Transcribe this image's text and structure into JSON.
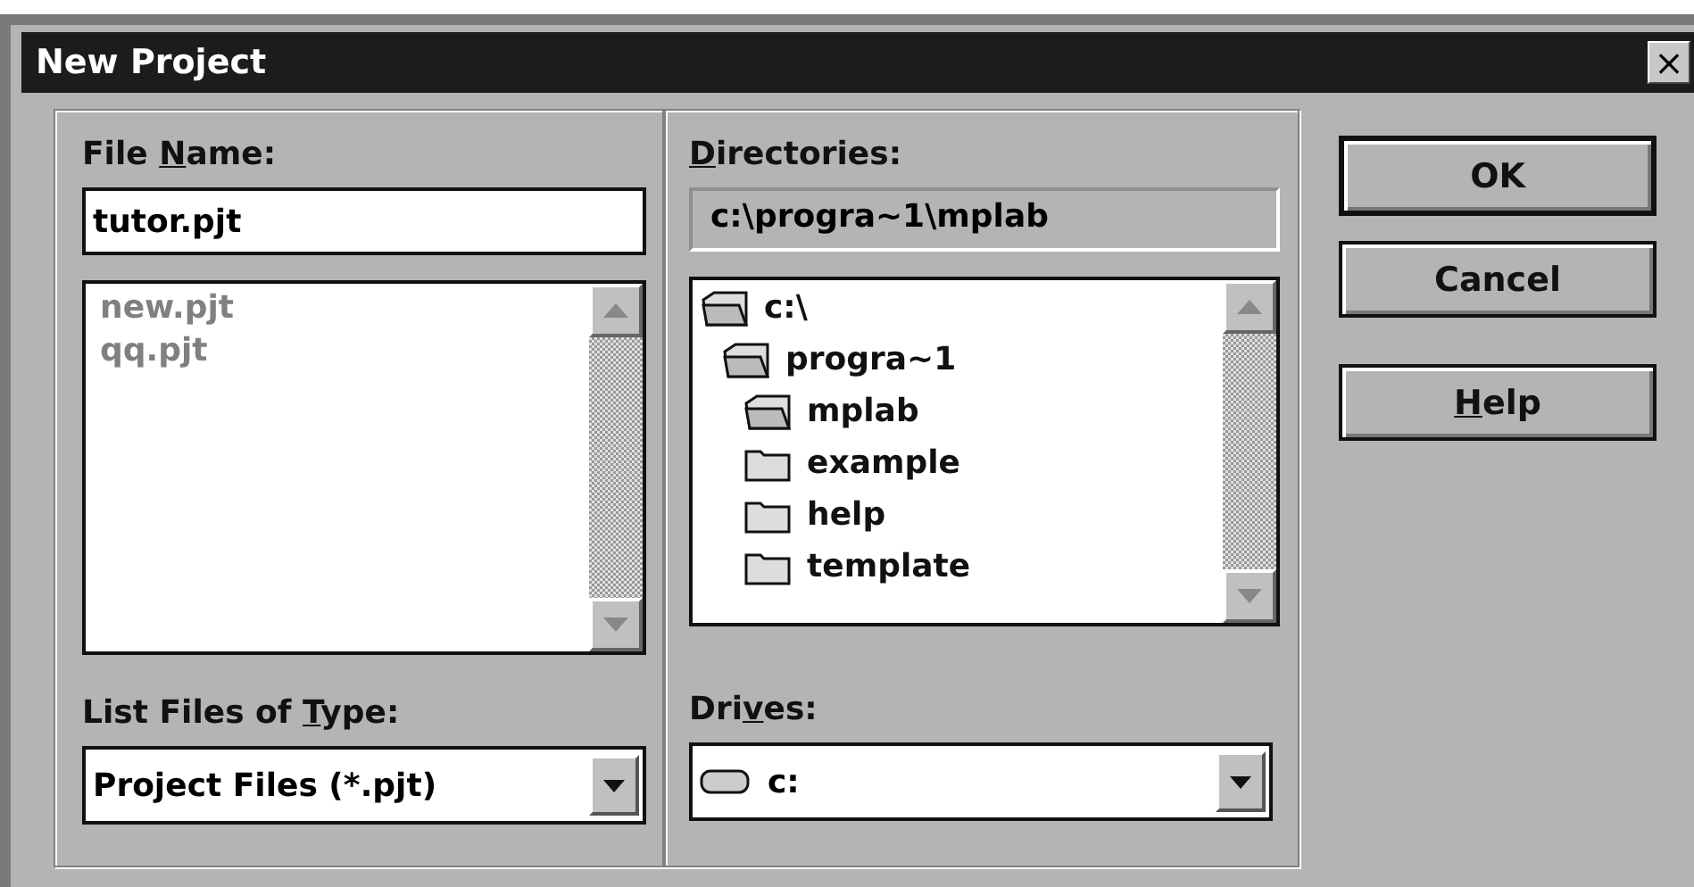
{
  "window": {
    "title": "New Project",
    "close": "×"
  },
  "file_name": {
    "label": {
      "before": "File ",
      "key": "N",
      "after": "ame:"
    },
    "value": "tutor.pjt"
  },
  "files": [
    {
      "name": "new.pjt"
    },
    {
      "name": "qq.pjt"
    }
  ],
  "file_type": {
    "label": {
      "before": "List Files of ",
      "key": "T",
      "after": "ype:"
    },
    "value": "Project Files (*.pjt)"
  },
  "directories": {
    "label": {
      "key": "D",
      "after": "irectories:"
    },
    "path": "c:\\progra~1\\mplab",
    "tree": [
      {
        "name": "c:\\",
        "expanded": true,
        "children": [
          {
            "name": "progra~1",
            "expanded": true,
            "children": [
              {
                "name": "mplab",
                "expanded": true,
                "children": [
                  {
                    "name": "example",
                    "expanded": false
                  },
                  {
                    "name": "help",
                    "expanded": false
                  },
                  {
                    "name": "template",
                    "expanded": false
                  }
                ]
              }
            ]
          }
        ]
      }
    ]
  },
  "drives": {
    "label": {
      "before": "Dri",
      "key": "v",
      "after": "es:"
    },
    "value": "c:"
  },
  "buttons": [
    {
      "label": {
        "after": "OK"
      },
      "default": true
    },
    {
      "label": {
        "after": "Cancel"
      },
      "default": false
    },
    {
      "label": {
        "key": "H",
        "after": "elp"
      },
      "default": false
    }
  ]
}
